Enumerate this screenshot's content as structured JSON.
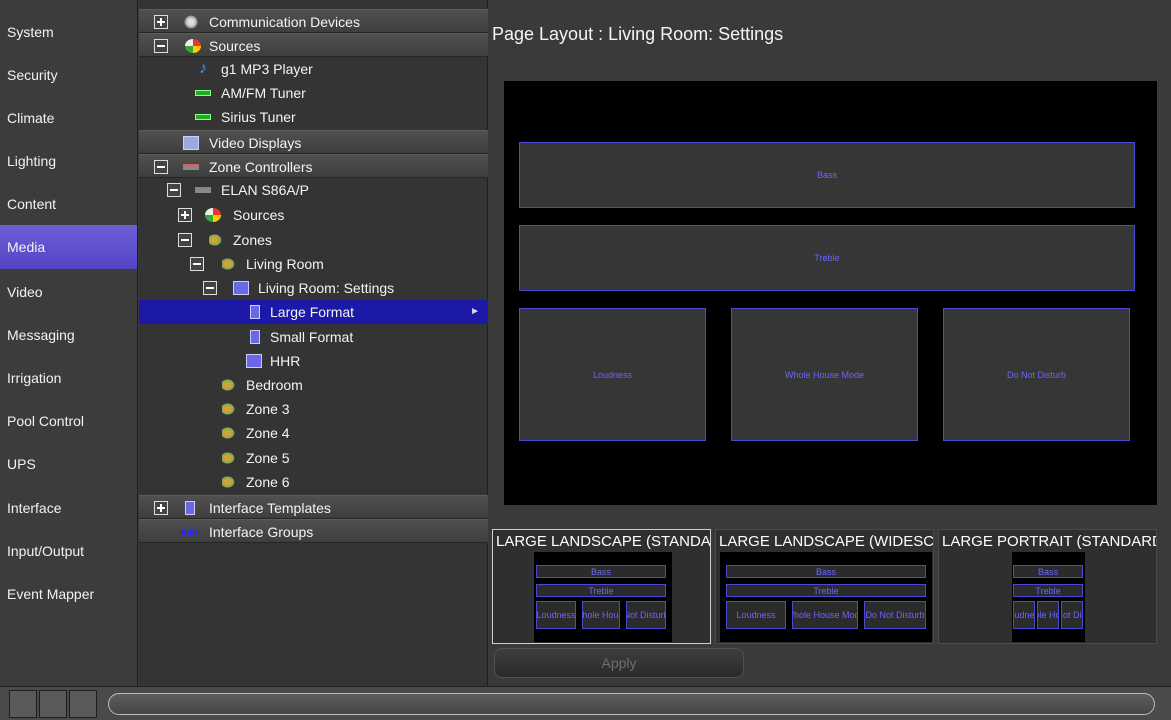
{
  "nav": {
    "items": [
      "System",
      "Security",
      "Climate",
      "Lighting",
      "Content",
      "Media",
      "Video",
      "Messaging",
      "Irrigation",
      "Pool Control",
      "UPS",
      "Interface",
      "Input/Output",
      "Event Mapper"
    ],
    "active": "Media"
  },
  "tree": {
    "rows": [
      {
        "label": "Communication Devices",
        "expander": "plus",
        "icon": "communication-devices-icon",
        "header": true
      },
      {
        "label": "Sources",
        "expander": "minus",
        "icon": "sources-icon",
        "header": true
      },
      {
        "label": "g1 MP3 Player",
        "icon": "music-note-icon"
      },
      {
        "label": "AM/FM Tuner",
        "icon": "tuner-icon"
      },
      {
        "label": "Sirius Tuner",
        "icon": "tuner-icon"
      },
      {
        "label": "Video Displays",
        "icon": "video-display-icon",
        "header": true
      },
      {
        "label": "Zone Controllers",
        "expander": "minus",
        "icon": "zone-controller-icon",
        "header": true
      },
      {
        "label": "ELAN S86A/P",
        "expander": "minus",
        "icon": "zone-controller-icon"
      },
      {
        "label": "Sources",
        "expander": "plus",
        "icon": "sources-icon"
      },
      {
        "label": "Zones",
        "expander": "minus",
        "icon": "speaker-icon"
      },
      {
        "label": "Living Room",
        "expander": "minus",
        "icon": "speaker-icon"
      },
      {
        "label": "Living Room: Settings",
        "expander": "minus",
        "icon": "settings-page-icon"
      },
      {
        "label": "Large Format",
        "icon": "page-icon",
        "selected": true
      },
      {
        "label": "Small Format",
        "icon": "page-icon"
      },
      {
        "label": "HHR",
        "icon": "settings-page-icon"
      },
      {
        "label": "Bedroom",
        "icon": "speaker-icon"
      },
      {
        "label": "Zone 3",
        "icon": "speaker-icon"
      },
      {
        "label": "Zone 4",
        "icon": "speaker-icon"
      },
      {
        "label": "Zone 5",
        "icon": "speaker-icon"
      },
      {
        "label": "Zone 6",
        "icon": "speaker-icon"
      },
      {
        "label": "Interface Templates",
        "expander": "plus",
        "icon": "template-icon",
        "header": true
      },
      {
        "label": "Interface Groups",
        "icon": "interface-groups-icon",
        "header": true
      }
    ]
  },
  "main": {
    "title": "Page Layout : Living Room: Settings",
    "slots": {
      "bass": "Bass",
      "treble": "Treble",
      "loudness": "Loudness",
      "whole_house": "Whole House Mode",
      "dnd": "Do Not Disturb"
    },
    "thumbnails": [
      {
        "title": "LARGE LANDSCAPE (STANDARD)",
        "labels": [
          "Bass",
          "Treble",
          "Loudness",
          "Whole House",
          "Not Disturb"
        ]
      },
      {
        "title": "LARGE LANDSCAPE (WIDESCREEN)",
        "labels": [
          "Bass",
          "Treble",
          "Loudness",
          "Whole House Mode",
          "Do Not Disturb"
        ]
      },
      {
        "title": "LARGE PORTRAIT (STANDARD)",
        "labels": [
          "Bass",
          "Treble",
          "Loudness",
          "Whole House",
          "Do Not Disturb"
        ]
      }
    ],
    "apply_label": "Apply"
  },
  "colors": {
    "nav_active": "#5a4bcc",
    "selected_row": "#1c18a8",
    "slot_border": "#4b48d6",
    "slot_text": "#6a66ff"
  }
}
